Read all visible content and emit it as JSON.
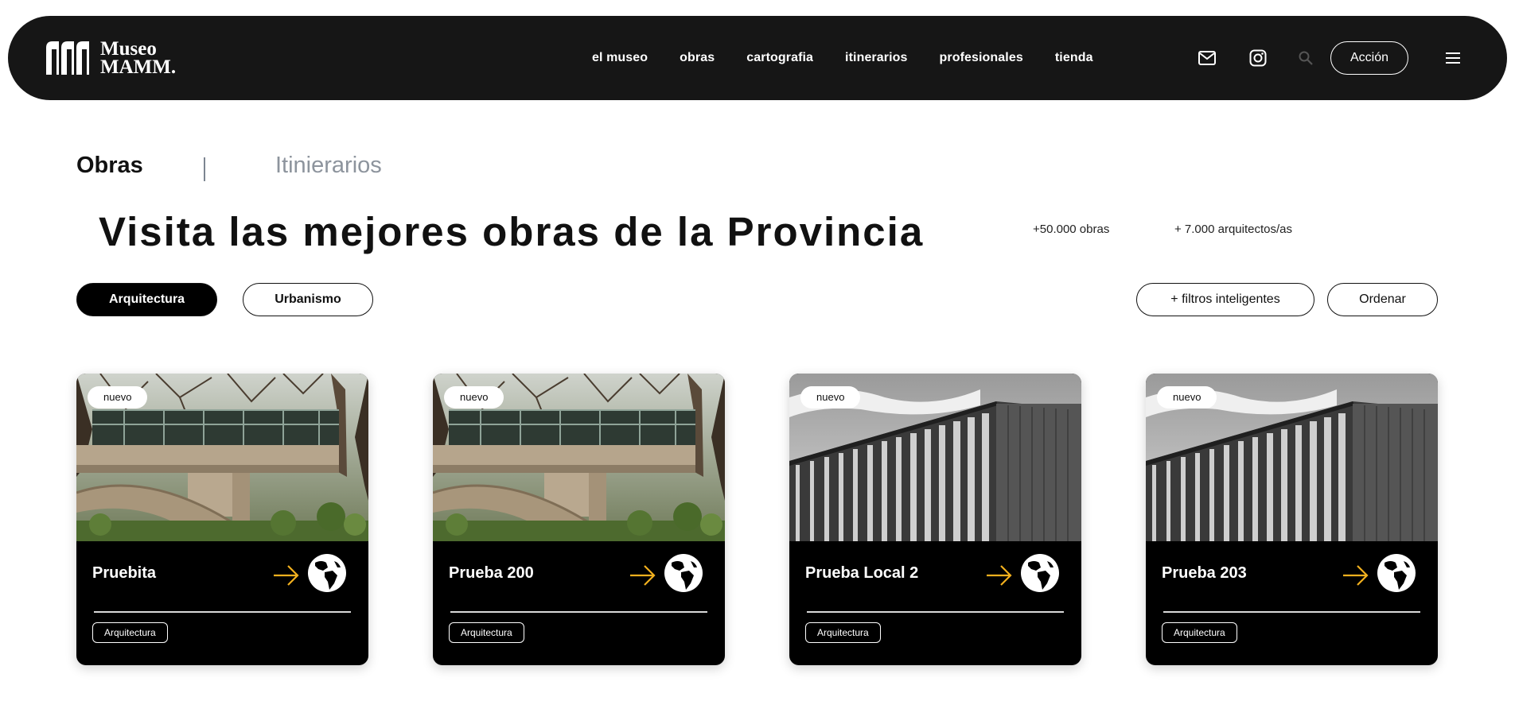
{
  "brand": {
    "line1": "Museo",
    "line2": "MAMM."
  },
  "nav": {
    "links": [
      "el museo",
      "obras",
      "cartografia",
      "itinerarios",
      "profesionales",
      "tienda"
    ],
    "action_label": "Acción"
  },
  "tabs": {
    "active": "Obras",
    "inactive": "Itinierarios"
  },
  "hero": {
    "title": "Visita las mejores obras de la Provincia",
    "stat_obras": "+50.000 obras",
    "stat_arquitectos": "+ 7.000 arquitectos/as"
  },
  "filters": {
    "category_active": "Arquitectura",
    "category_other": "Urbanismo",
    "smart_filters": "+ filtros inteligentes",
    "sort": "Ordenar"
  },
  "cards": [
    {
      "badge": "nuevo",
      "title": "Pruebita",
      "tag": "Arquitectura",
      "image": "modernist-house-forest"
    },
    {
      "badge": "nuevo",
      "title": "Prueba 200",
      "tag": "Arquitectura",
      "image": "modernist-house-forest"
    },
    {
      "badge": "nuevo",
      "title": "Prueba Local 2",
      "tag": "Arquitectura",
      "image": "vertical-slat-building-bw"
    },
    {
      "badge": "nuevo",
      "title": "Prueba 203",
      "tag": "Arquitectura",
      "image": "vertical-slat-building-bw"
    }
  ],
  "colors": {
    "navbar": "#161616",
    "accent_arrow": "#f2b01e",
    "muted_tab": "#8d949d"
  },
  "icons": [
    "mail-icon",
    "instagram-icon",
    "search-icon",
    "menu-icon",
    "arrow-right-icon",
    "globe-icon"
  ]
}
